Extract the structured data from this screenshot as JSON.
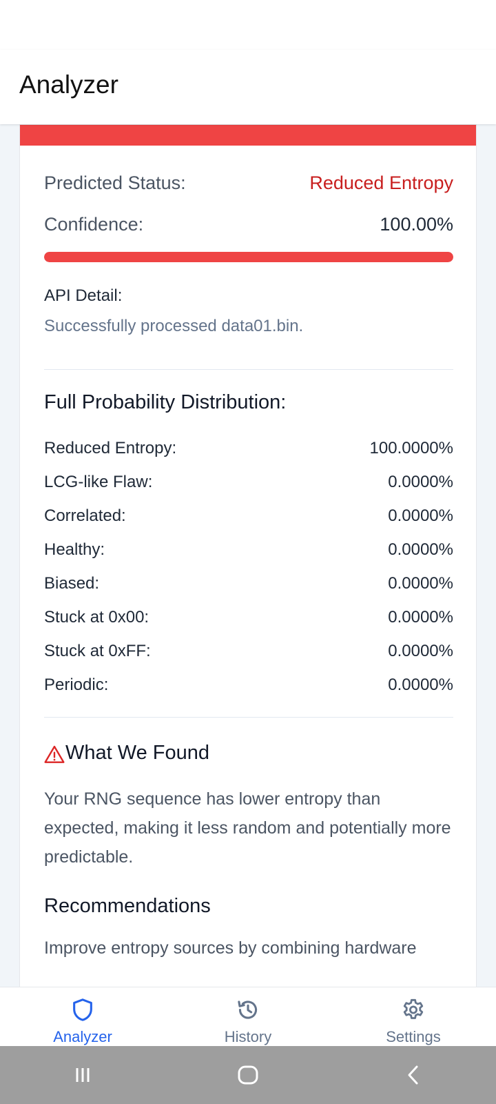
{
  "app": {
    "title": "Analyzer"
  },
  "colors": {
    "accent_red": "#ef4444",
    "status_red": "#c81e1e",
    "nav_active": "#2563eb",
    "nav_inactive": "#64748b"
  },
  "result": {
    "status_label": "Predicted Status:",
    "status_value": "Reduced Entropy",
    "confidence_label": "Confidence:",
    "confidence_value": "100.00%",
    "confidence_fraction": 1.0,
    "api_label": "API Detail:",
    "api_detail": "Successfully processed data01.bin."
  },
  "distribution": {
    "title": "Full Probability Distribution:",
    "items": [
      {
        "label": "Reduced Entropy:",
        "value": "100.0000%"
      },
      {
        "label": "LCG-like Flaw:",
        "value": "0.0000%"
      },
      {
        "label": "Correlated:",
        "value": "0.0000%"
      },
      {
        "label": "Healthy:",
        "value": "0.0000%"
      },
      {
        "label": "Biased:",
        "value": "0.0000%"
      },
      {
        "label": "Stuck at 0x00:",
        "value": "0.0000%"
      },
      {
        "label": "Stuck at 0xFF:",
        "value": "0.0000%"
      },
      {
        "label": "Periodic:",
        "value": "0.0000%"
      }
    ]
  },
  "findings": {
    "icon": "warning-triangle-icon",
    "title": "What We Found",
    "body": "Your RNG sequence has lower entropy than expected, making it less random and potentially more predictable."
  },
  "recommendations": {
    "title": "Recommendations",
    "body": "Improve entropy sources by combining hardware"
  },
  "bottom_nav": {
    "items": [
      {
        "label": "Analyzer",
        "icon": "shield-icon",
        "active": true
      },
      {
        "label": "History",
        "icon": "history-icon",
        "active": false
      },
      {
        "label": "Settings",
        "icon": "gear-icon",
        "active": false
      }
    ]
  },
  "system_nav": {
    "icons": [
      "recent-apps-icon",
      "home-icon",
      "back-icon"
    ]
  }
}
